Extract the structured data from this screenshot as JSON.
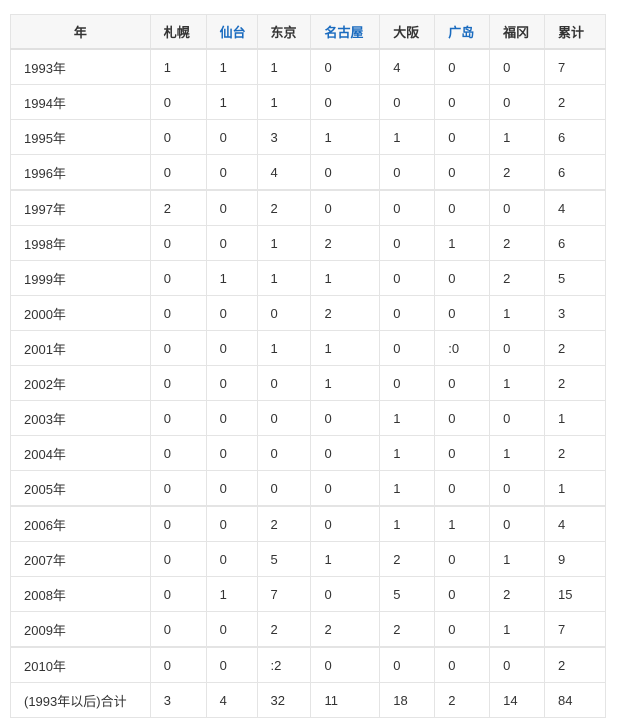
{
  "headers": [
    {
      "label": "年",
      "link": false
    },
    {
      "label": "札幌",
      "link": false
    },
    {
      "label": "仙台",
      "link": true
    },
    {
      "label": "东京",
      "link": false
    },
    {
      "label": "名古屋",
      "link": true
    },
    {
      "label": "大阪",
      "link": false
    },
    {
      "label": "广岛",
      "link": true
    },
    {
      "label": "福冈",
      "link": false
    },
    {
      "label": "累计",
      "link": false
    }
  ],
  "rows": [
    [
      "1993年",
      "1",
      "1",
      "1",
      "0",
      "4",
      "0",
      "0",
      "7"
    ],
    [
      "1994年",
      "0",
      "1",
      "1",
      "0",
      "0",
      "0",
      "0",
      "2"
    ],
    [
      "1995年",
      "0",
      "0",
      "3",
      "1",
      "1",
      "0",
      "1",
      "6"
    ],
    [
      "1996年",
      "0",
      "0",
      "4",
      "0",
      "0",
      "0",
      "2",
      "6"
    ],
    [
      "1997年",
      "2",
      "0",
      "2",
      "0",
      "0",
      "0",
      "0",
      "4"
    ],
    [
      "1998年",
      "0",
      "0",
      "1",
      "2",
      "0",
      "1",
      "2",
      "6"
    ],
    [
      "1999年",
      "0",
      "1",
      "1",
      "1",
      "0",
      "0",
      "2",
      "5"
    ],
    [
      "2000年",
      "0",
      "0",
      "0",
      "2",
      "0",
      "0",
      "1",
      "3"
    ],
    [
      "2001年",
      "0",
      "0",
      "1",
      "1",
      "0",
      ":0",
      "0",
      "2"
    ],
    [
      "2002年",
      "0",
      "0",
      "0",
      "1",
      "0",
      "0",
      "1",
      "2"
    ],
    [
      "2003年",
      "0",
      "0",
      "0",
      "0",
      "1",
      "0",
      "0",
      "1"
    ],
    [
      "2004年",
      "0",
      "0",
      "0",
      "0",
      "1",
      "0",
      "1",
      "2"
    ],
    [
      "2005年",
      "0",
      "0",
      "0",
      "0",
      "1",
      "0",
      "0",
      "1"
    ],
    [
      "2006年",
      "0",
      "0",
      "2",
      "0",
      "1",
      "1",
      "0",
      "4"
    ],
    [
      "2007年",
      "0",
      "0",
      "5",
      "1",
      "2",
      "0",
      "1",
      "9"
    ],
    [
      "2008年",
      "0",
      "1",
      "7",
      "0",
      "5",
      "0",
      "2",
      "15"
    ],
    [
      "2009年",
      "0",
      "0",
      "2",
      "2",
      "2",
      "0",
      "1",
      "7"
    ],
    [
      "2010年",
      "0",
      "0",
      ":2",
      "0",
      "0",
      "0",
      "0",
      "2"
    ],
    [
      "(1993年以后)合计",
      "3",
      "4",
      "32",
      "11",
      "18",
      "2",
      "14",
      "84"
    ]
  ],
  "separator_rows": [
    4,
    13,
    17
  ],
  "colors": {
    "link": "#1a6bbf"
  }
}
